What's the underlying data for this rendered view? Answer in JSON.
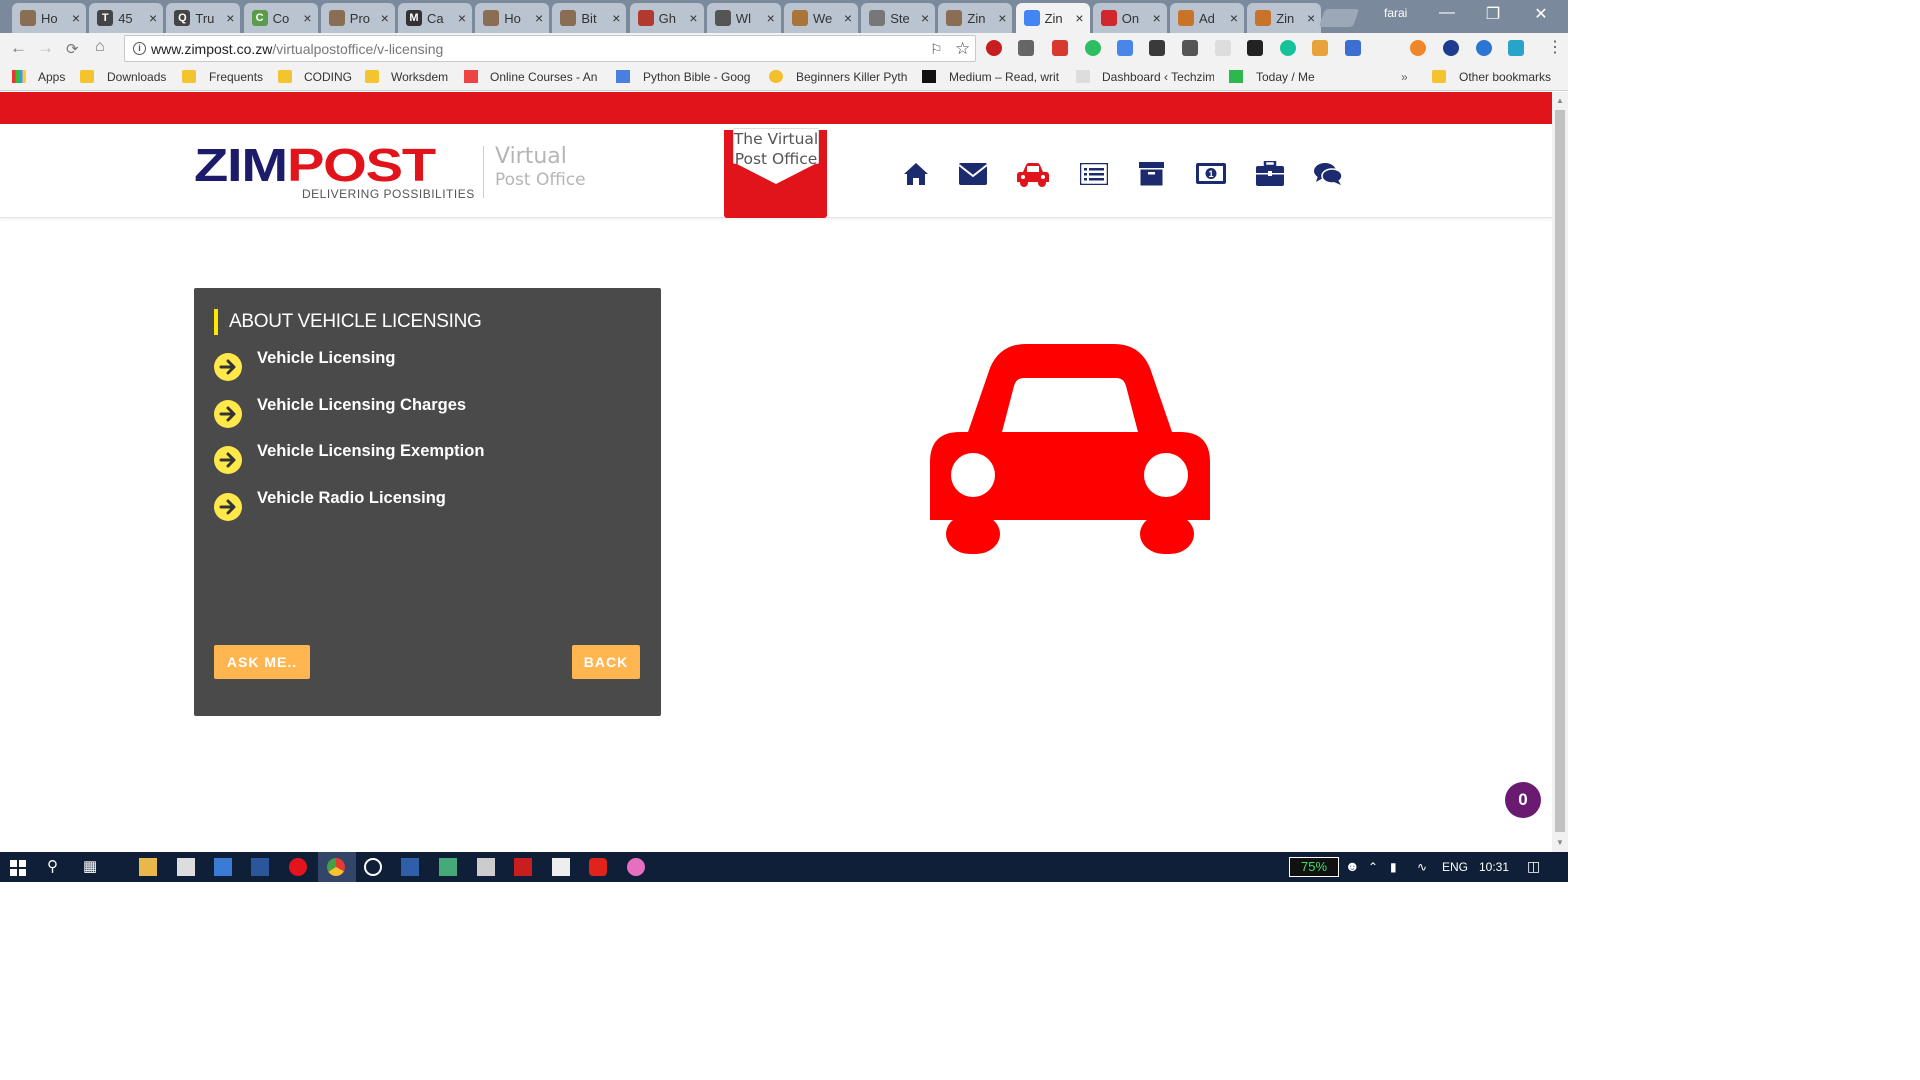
{
  "browser": {
    "tabs": [
      {
        "label": "Ho",
        "fav": ""
      },
      {
        "label": "45",
        "fav": "T"
      },
      {
        "label": "Tru",
        "fav": "Q"
      },
      {
        "label": "Co",
        "fav": "C"
      },
      {
        "label": "Pro",
        "fav": ""
      },
      {
        "label": "Ca",
        "fav": "M"
      },
      {
        "label": "Ho",
        "fav": ""
      },
      {
        "label": "Bit",
        "fav": ""
      },
      {
        "label": "Gh",
        "fav": ""
      },
      {
        "label": "Wl",
        "fav": ""
      },
      {
        "label": "We",
        "fav": ""
      },
      {
        "label": "Ste",
        "fav": ""
      },
      {
        "label": "Zin",
        "fav": ""
      },
      {
        "label": "Zin",
        "fav": ""
      },
      {
        "label": "On",
        "fav": ""
      },
      {
        "label": "Ad",
        "fav": ""
      },
      {
        "label": "Zin",
        "fav": ""
      }
    ],
    "tab_close": "×",
    "profile_name": "farai",
    "url_host": "www.zimpost.co.zw",
    "url_path": "/virtualpostoffice/v-licensing",
    "bookmarks": [
      "Apps",
      "Downloads",
      "Frequents",
      "CODING",
      "Worksdem",
      "Online Courses - An",
      "Python Bible - Goog",
      "Beginners Killer Pyth",
      "Medium – Read, writ",
      "Dashboard ‹ Techzim",
      "Today / Me"
    ],
    "bookmarks_overflow": "»",
    "other_bookmarks": "Other bookmarks"
  },
  "header": {
    "logo_zim": "ZIM",
    "logo_post": "POST",
    "logo_tagline": "DELIVERING POSSIBILITIES",
    "subtitle_line1": "Virtual",
    "subtitle_line2": "Post Office",
    "envelope_line1": "The Virtual",
    "envelope_line2": "Post Office",
    "nav_icons": [
      "home-icon",
      "envelope-icon",
      "car-icon",
      "list-icon",
      "archive-icon",
      "money-icon",
      "briefcase-icon",
      "comments-icon"
    ]
  },
  "panel": {
    "title": "ABOUT VEHICLE LICENSING",
    "items": [
      "Vehicle Licensing",
      "Vehicle Licensing Charges",
      "Vehicle Licensing Exemption",
      "Vehicle Radio Licensing"
    ],
    "ask_button": "ASK ME..",
    "back_button": "BACK"
  },
  "chat_badge": "0",
  "taskbar": {
    "battery_pct": "75%",
    "language": "ENG",
    "time": "10:31"
  },
  "colors": {
    "brand_red": "#e0141a",
    "brand_navy": "#1c1c6b",
    "panel_bg": "#4a4a4a",
    "accent_yellow": "#ffe94a",
    "button_orange": "#ffb550",
    "car_red": "#ff0000"
  }
}
